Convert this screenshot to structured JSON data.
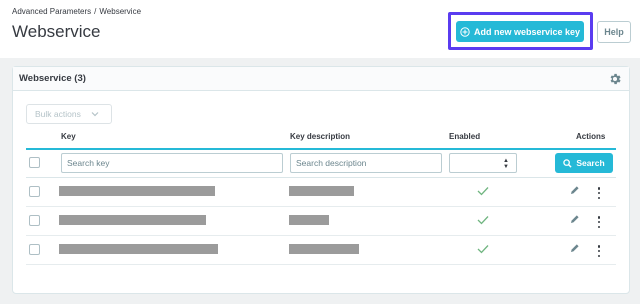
{
  "breadcrumb": {
    "parent": "Advanced Parameters",
    "separator": "/",
    "current": "Webservice"
  },
  "page_title": "Webservice",
  "toolbar": {
    "add_label": "Add new webservice key",
    "help_label": "Help"
  },
  "card": {
    "title": "Webservice (3)"
  },
  "bulk": {
    "label": "Bulk actions"
  },
  "table": {
    "columns": {
      "key": "Key",
      "description": "Key description",
      "enabled": "Enabled",
      "actions": "Actions"
    },
    "filters": {
      "key_placeholder": "Search key",
      "description_placeholder": "Search description",
      "search_label": "Search"
    },
    "rows": [
      {
        "key": "",
        "description": "",
        "enabled": true
      },
      {
        "key": "",
        "description": "",
        "enabled": true
      },
      {
        "key": "",
        "description": "",
        "enabled": true
      }
    ]
  },
  "colors": {
    "accent": "#25b9d7",
    "highlight": "#5a3cf0",
    "enabled_check": "#70b580",
    "redacted": "#9b9b9b"
  },
  "icons": [
    "add-circle-icon",
    "gear-icon",
    "chevron-down-icon",
    "sort-arrows-icon",
    "search-icon",
    "check-icon",
    "pencil-icon",
    "kebab-icon"
  ]
}
